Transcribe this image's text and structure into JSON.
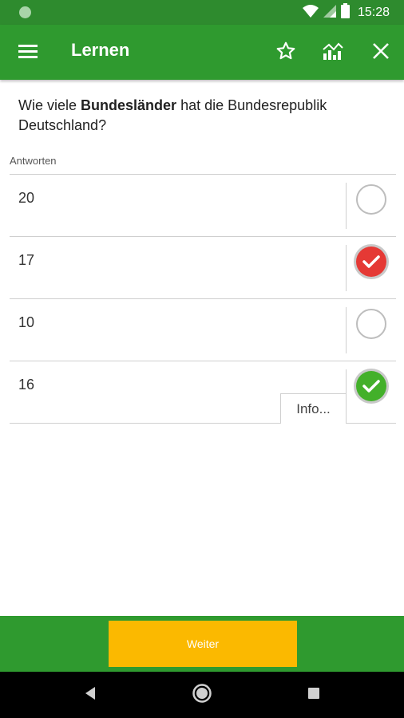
{
  "status_bar": {
    "time": "15:28"
  },
  "app_bar": {
    "title": "Lernen"
  },
  "question": {
    "prefix": "Wie viele ",
    "highlight": "Bundesländer",
    "suffix": " hat die Bundesrepublik Deutschland?"
  },
  "answers_label": "Antworten",
  "answers": [
    {
      "text": "20",
      "state": "unselected"
    },
    {
      "text": "17",
      "state": "selected-wrong"
    },
    {
      "text": "10",
      "state": "unselected"
    },
    {
      "text": "16",
      "state": "correct",
      "info_label": "Info..."
    }
  ],
  "bottom": {
    "next_label": "Weiter"
  },
  "colors": {
    "primary": "#2f9a2f",
    "accent": "#fbb900",
    "wrong": "#e53935",
    "correct": "#43b02a"
  },
  "icons": [
    "menu-icon",
    "star-icon",
    "stats-icon",
    "close-icon",
    "wifi-icon",
    "signal-icon",
    "battery-icon",
    "back-icon",
    "home-icon",
    "recents-icon"
  ]
}
